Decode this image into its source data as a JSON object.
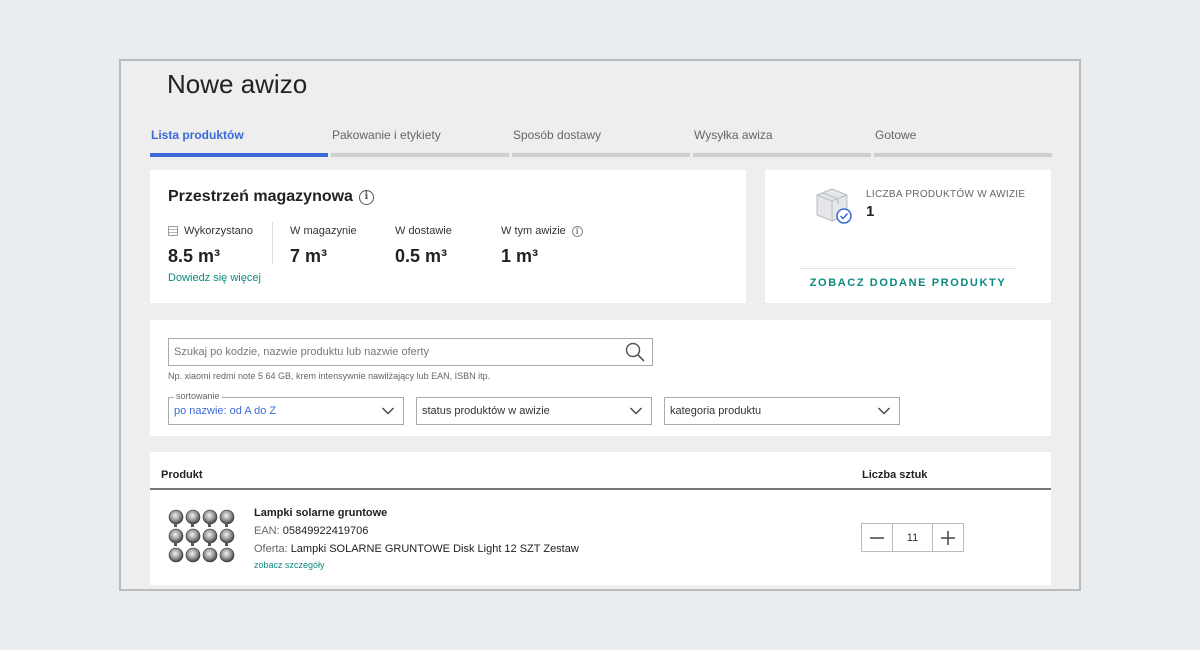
{
  "page": {
    "title": "Nowe awizo"
  },
  "steps": [
    {
      "label": "Lista produktów",
      "active": true
    },
    {
      "label": "Pakowanie i etykiety"
    },
    {
      "label": "Sposób dostawy"
    },
    {
      "label": "Wysyłka awiza"
    },
    {
      "label": "Gotowe"
    }
  ],
  "storage": {
    "title": "Przestrzeń magazynowa",
    "stats": [
      {
        "label": "Wykorzystano",
        "value": "8.5 m³"
      },
      {
        "label": "W magazynie",
        "value": "7 m³"
      },
      {
        "label": "W dostawie",
        "value": "0.5 m³"
      },
      {
        "label": "W tym awizie",
        "value": "1 m³"
      }
    ],
    "learn_more": "Dowiedz się więcej"
  },
  "count": {
    "label": "LICZBA PRODUKTÓW W AWIZIE",
    "value": "1",
    "button": "ZOBACZ DODANE PRODUKTY"
  },
  "search": {
    "placeholder": "Szukaj po kodzie, nazwie produktu lub nazwie oferty",
    "hint": "Np. xiaomi redmi note 5 64 GB, krem intensywnie nawilżający lub EAN, ISBN itp."
  },
  "filters": {
    "sort": {
      "label": "sortowanie",
      "value": "po nazwie: od A do Z"
    },
    "status": {
      "value": "status produktów w awizie"
    },
    "category": {
      "value": "kategoria produktu"
    }
  },
  "table": {
    "headers": {
      "product": "Produkt",
      "quantity": "Liczba sztuk"
    },
    "rows": [
      {
        "name": "Lampki solarne gruntowe",
        "ean_key": "EAN:",
        "ean": "05849922419706",
        "offer_key": "Oferta:",
        "offer": "Lampki SOLARNE GRUNTOWE Disk Light 12 SZT Zestaw",
        "details": "zobacz szczegóły",
        "quantity": "11"
      }
    ]
  },
  "colors": {
    "accent_blue": "#3b6ad8",
    "accent_teal": "#0a8a7e"
  },
  "icons": [
    "info-icon",
    "document-icon",
    "box-check-icon",
    "search-icon",
    "chevron-down-icon",
    "minus-icon",
    "plus-icon"
  ]
}
